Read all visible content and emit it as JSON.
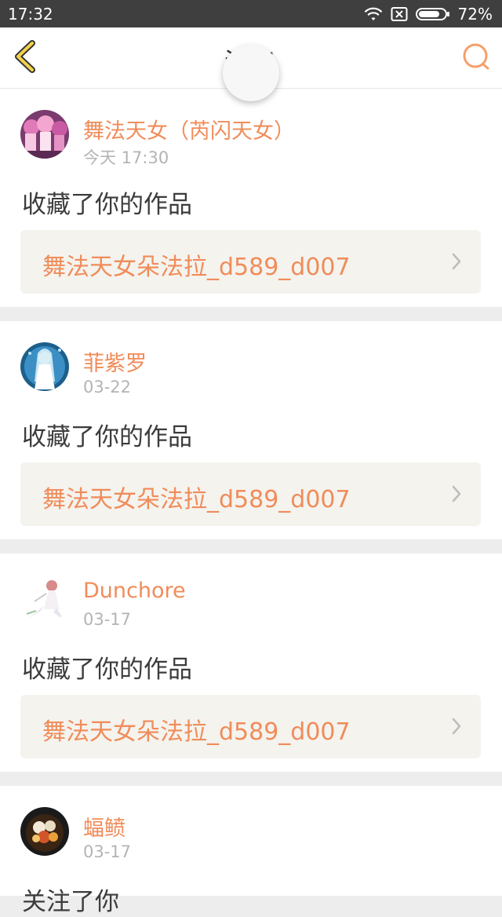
{
  "status_bar": {
    "time": "17:32",
    "battery": "72%",
    "icons": [
      "wifi-icon",
      "no-sim-icon",
      "battery-icon"
    ]
  },
  "nav": {
    "title": "消息",
    "back_icon": "chevron-left-icon",
    "search_icon": "search-icon",
    "accent": "#f5a623"
  },
  "colors": {
    "name": "#f08c5a",
    "work": "#f08c5a",
    "time": "#b4b4b4",
    "action": "#3c3c3c",
    "work_bg": "#f4f3ee",
    "divider": "#ededed"
  },
  "messages": [
    {
      "user": "舞法天女（芮闪天女）",
      "time": "今天 17:30",
      "action": "收藏了你的作品",
      "work": "舞法天女朵法拉_d589_d007",
      "avatar": "avatar-pink-characters"
    },
    {
      "user": "菲紫罗",
      "time": "03-22",
      "action": "收藏了你的作品",
      "work": "舞法天女朵法拉_d589_d007",
      "avatar": "avatar-blue-fairy"
    },
    {
      "user": "Dunchore",
      "time": "03-17",
      "action": "收藏了你的作品",
      "work": "舞法天女朵法拉_d589_d007",
      "avatar": "avatar-white-dress-girl"
    },
    {
      "user": "蝠鲼",
      "time": "03-17",
      "action": "关注了你",
      "avatar": "avatar-food-photo"
    }
  ]
}
